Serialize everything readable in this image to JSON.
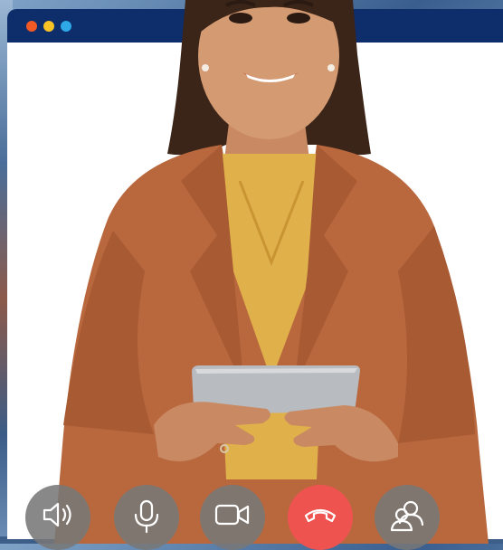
{
  "window": {
    "title_dots": [
      "close",
      "minimize",
      "maximize"
    ],
    "colors": {
      "titlebar": "#0d2d6b",
      "close_dot": "#f15a24",
      "minimize_dot": "#f7c325",
      "maximize_dot": "#2ea8e6"
    }
  },
  "call_controls": [
    {
      "id": "speaker",
      "icon": "speaker-icon"
    },
    {
      "id": "microphone",
      "icon": "microphone-icon"
    },
    {
      "id": "camera",
      "icon": "video-camera-icon"
    },
    {
      "id": "hang-up",
      "icon": "phone-hangup-icon",
      "color": "#ef5350"
    },
    {
      "id": "participants",
      "icon": "participants-icon"
    }
  ]
}
